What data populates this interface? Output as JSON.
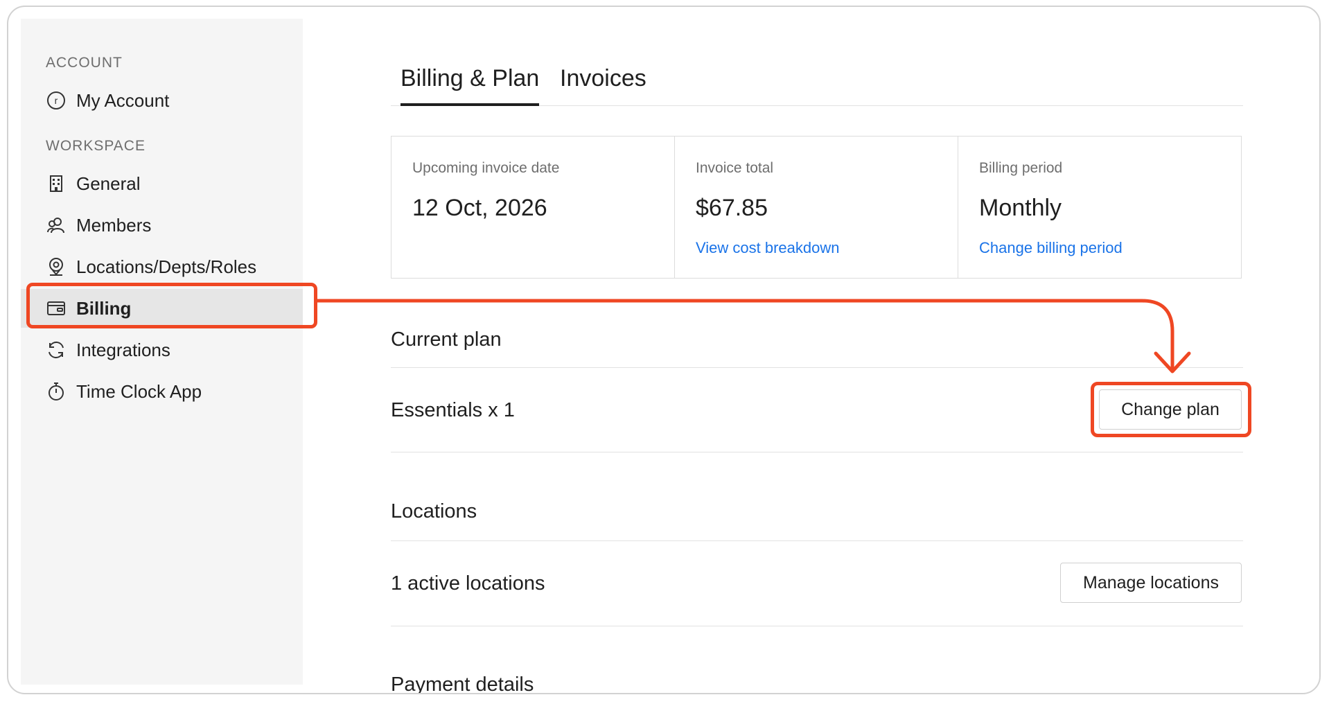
{
  "sidebar": {
    "sections": [
      {
        "label": "ACCOUNT"
      },
      {
        "label": "WORKSPACE"
      }
    ],
    "items": [
      {
        "label": "My Account",
        "icon": "account-circle-icon"
      },
      {
        "label": "General",
        "icon": "building-icon"
      },
      {
        "label": "Members",
        "icon": "members-icon"
      },
      {
        "label": "Locations/Depts/Roles",
        "icon": "location-pin-icon"
      },
      {
        "label": "Billing",
        "icon": "billing-card-icon",
        "active": true
      },
      {
        "label": "Integrations",
        "icon": "sync-icon"
      },
      {
        "label": "Time Clock App",
        "icon": "stopwatch-icon"
      }
    ],
    "account_initial": "r"
  },
  "tabs": [
    {
      "label": "Billing & Plan",
      "active": true
    },
    {
      "label": "Invoices",
      "active": false
    }
  ],
  "summary": {
    "invoice_date": {
      "label": "Upcoming invoice date",
      "value": "12 Oct, 2026"
    },
    "invoice_total": {
      "label": "Invoice total",
      "value": "$67.85",
      "link": "View cost breakdown"
    },
    "billing_period": {
      "label": "Billing period",
      "value": "Monthly",
      "link": "Change billing period"
    }
  },
  "current_plan": {
    "title": "Current plan",
    "plan": "Essentials x 1",
    "button": "Change plan"
  },
  "locations": {
    "title": "Locations",
    "text": "1 active locations",
    "button": "Manage locations"
  },
  "payment": {
    "title": "Payment details"
  },
  "colors": {
    "accent": "#1a73e8",
    "highlight": "#ef4723",
    "sidebar_bg": "#f5f5f5",
    "active_bg": "#e6e6e6"
  }
}
